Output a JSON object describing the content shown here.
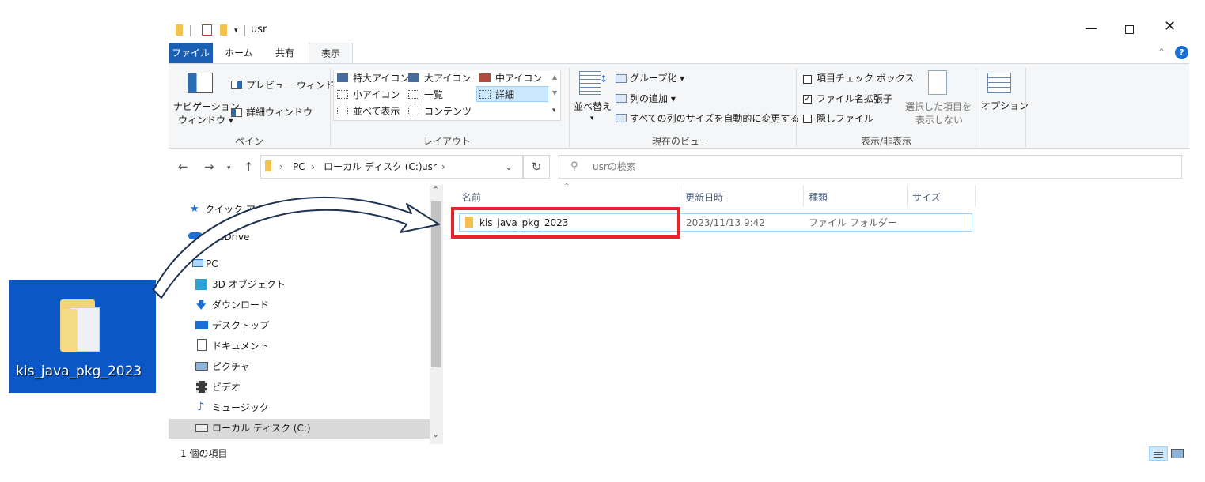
{
  "window": {
    "title": "usr"
  },
  "tabs": [
    "ファイル",
    "ホーム",
    "共有",
    "表示"
  ],
  "ribbon": {
    "pane": {
      "nav_pane_line1": "ナビゲーション",
      "nav_pane_line2": "ウィンドウ",
      "preview": "プレビュー ウィンドウ",
      "details": "詳細ウィンドウ",
      "label": "ペイン"
    },
    "layout": {
      "items": [
        "特大アイコン",
        "大アイコン",
        "中アイコン",
        "小アイコン",
        "一覧",
        "詳細",
        "並べて表示",
        "コンテンツ"
      ],
      "label": "レイアウト"
    },
    "current_view": {
      "sort": "並べ替え",
      "group": "グループ化",
      "add_column": "列の追加",
      "autosize": "すべての列のサイズを自動的に変更する",
      "label": "現在のビュー"
    },
    "show_hide": {
      "item_checkbox": "項目チェック ボックス",
      "extensions": "ファイル名拡張子",
      "hidden": "隠しファイル",
      "hide_selected_line1": "選択した項目を",
      "hide_selected_line2": "表示しない",
      "label": "表示/非表示"
    },
    "options": {
      "label": "オプション"
    }
  },
  "address": {
    "crumbs": [
      "PC",
      "ローカル ディスク (C:)",
      "usr"
    ],
    "search_placeholder": "usrの検索"
  },
  "nav_pane": {
    "items": [
      "クイック アクセス",
      "OneDrive",
      "PC",
      "3D オブジェクト",
      "ダウンロード",
      "デスクトップ",
      "ドキュメント",
      "ピクチャ",
      "ビデオ",
      "ミュージック",
      "ローカル ディスク (C:)"
    ]
  },
  "columns": [
    "名前",
    "更新日時",
    "種類",
    "サイズ"
  ],
  "files": [
    {
      "name": "kis_java_pkg_2023",
      "modified": "2023/11/13 9:42",
      "type": "ファイル フォルダー",
      "size": ""
    }
  ],
  "status": {
    "count": "1 個の項目"
  },
  "desktop_icon": {
    "label": "kis_java_pkg_2023"
  },
  "colors": {
    "accent": "#1a5fb4",
    "highlight": "#e8232b",
    "selected": "#cce8ff"
  }
}
